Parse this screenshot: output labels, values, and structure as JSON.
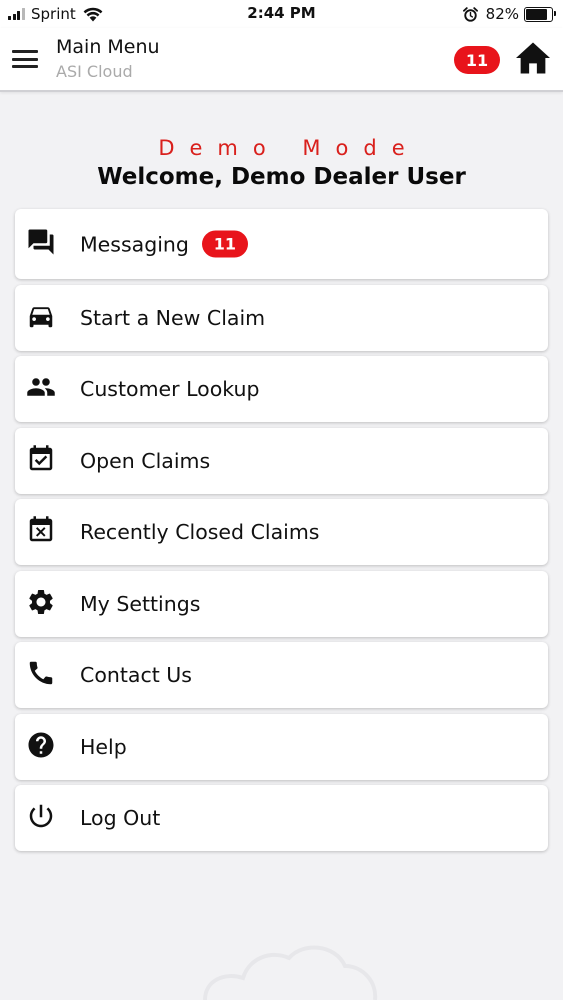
{
  "status_bar": {
    "carrier": "Sprint",
    "time": "2:44 PM",
    "battery_percent": "82%",
    "battery_level": 0.82
  },
  "header": {
    "title": "Main Menu",
    "subtitle": "ASI Cloud",
    "badge_count": "11"
  },
  "welcome": {
    "mode": "Demo Mode",
    "greeting": "Welcome, Demo Dealer User"
  },
  "menu": {
    "items": [
      {
        "label": "Messaging",
        "icon": "chat-icon",
        "badge": "11"
      },
      {
        "label": "Start a New Claim",
        "icon": "car-icon"
      },
      {
        "label": "Customer Lookup",
        "icon": "people-icon"
      },
      {
        "label": "Open Claims",
        "icon": "calendar-check-icon"
      },
      {
        "label": "Recently Closed Claims",
        "icon": "calendar-x-icon"
      },
      {
        "label": "My Settings",
        "icon": "gear-icon"
      },
      {
        "label": "Contact Us",
        "icon": "phone-icon"
      },
      {
        "label": "Help",
        "icon": "help-icon"
      },
      {
        "label": "Log Out",
        "icon": "power-icon"
      }
    ]
  },
  "colors": {
    "badge": "#e8141b",
    "demo_mode": "#d9201c",
    "background": "#f2f2f4",
    "subtitle": "#aaaaaa"
  }
}
